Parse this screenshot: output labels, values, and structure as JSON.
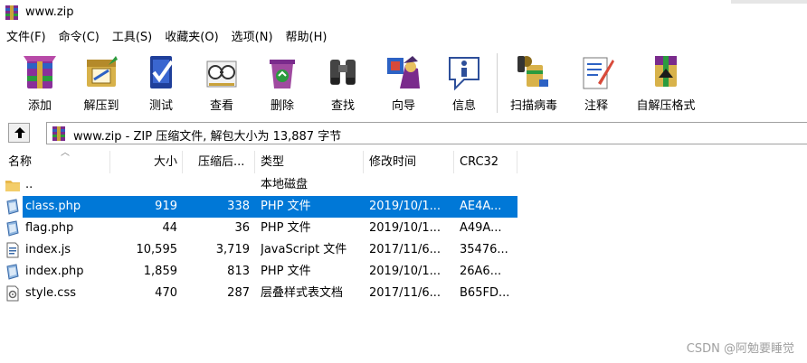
{
  "window": {
    "title": "www.zip"
  },
  "menu": [
    "文件(F)",
    "命令(C)",
    "工具(S)",
    "收藏夹(O)",
    "选项(N)",
    "帮助(H)"
  ],
  "toolbar": [
    {
      "label": "添加",
      "icon": "add-archive-icon"
    },
    {
      "label": "解压到",
      "icon": "extract-to-icon"
    },
    {
      "label": "测试",
      "icon": "test-icon"
    },
    {
      "label": "查看",
      "icon": "view-icon"
    },
    {
      "label": "删除",
      "icon": "delete-icon"
    },
    {
      "label": "查找",
      "icon": "find-binoculars-icon"
    },
    {
      "label": "向导",
      "icon": "wizard-icon"
    },
    {
      "label": "信息",
      "icon": "info-icon"
    },
    {
      "label": "扫描病毒",
      "icon": "virus-scan-icon"
    },
    {
      "label": "注释",
      "icon": "comment-icon"
    },
    {
      "label": "自解压格式",
      "icon": "sfx-icon"
    }
  ],
  "pathbar": {
    "text": "www.zip - ZIP 压缩文件, 解包大小为 13,887 字节"
  },
  "columns": {
    "name": "名称",
    "size": "大小",
    "packed": "压缩后...",
    "type": "类型",
    "modified": "修改时间",
    "crc": "CRC32"
  },
  "rows": [
    {
      "name": "..",
      "size": "",
      "packed": "",
      "type": "本地磁盘",
      "modified": "",
      "crc": "",
      "icon": "folder-up-icon",
      "selected": false
    },
    {
      "name": "class.php",
      "size": "919",
      "packed": "338",
      "type": "PHP 文件",
      "modified": "2019/10/1...",
      "crc": "AE4A...",
      "icon": "php-file-icon",
      "selected": true
    },
    {
      "name": "flag.php",
      "size": "44",
      "packed": "36",
      "type": "PHP 文件",
      "modified": "2019/10/1...",
      "crc": "A49A...",
      "icon": "php-file-icon",
      "selected": false
    },
    {
      "name": "index.js",
      "size": "10,595",
      "packed": "3,719",
      "type": "JavaScript 文件",
      "modified": "2017/11/6...",
      "crc": "35476...",
      "icon": "js-file-icon",
      "selected": false
    },
    {
      "name": "index.php",
      "size": "1,859",
      "packed": "813",
      "type": "PHP 文件",
      "modified": "2019/10/1...",
      "crc": "26A6...",
      "icon": "php-file-icon",
      "selected": false
    },
    {
      "name": "style.css",
      "size": "470",
      "packed": "287",
      "type": "层叠样式表文档",
      "modified": "2017/11/6...",
      "crc": "B65FD...",
      "icon": "css-file-icon",
      "selected": false
    }
  ],
  "watermark": "CSDN @阿勉要睡觉",
  "colors": {
    "selection": "#0078d7",
    "accent_folder": "#e8b84a"
  }
}
